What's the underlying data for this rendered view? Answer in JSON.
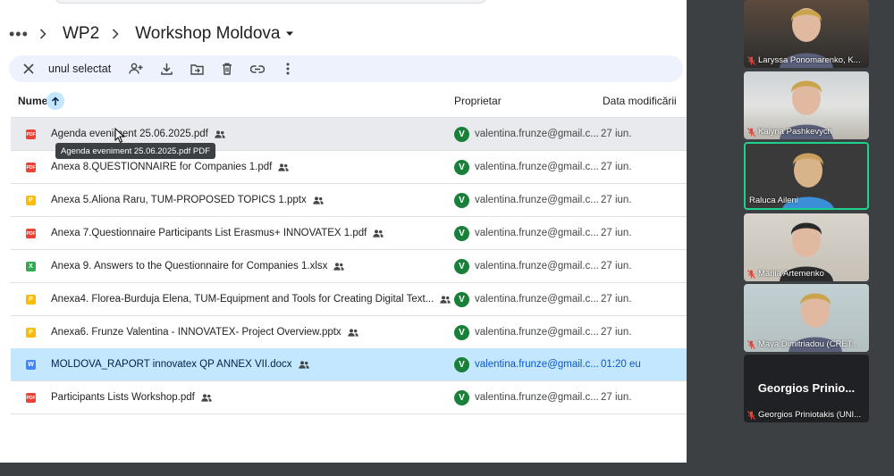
{
  "breadcrumb": {
    "more": "•••",
    "items": [
      "WP2",
      "Workshop Moldova"
    ]
  },
  "selection_bar": {
    "count_label": "unul selectat",
    "actions": [
      "close-icon",
      "share-icon",
      "download-icon",
      "move-icon",
      "trash-icon",
      "link-icon",
      "more-vert-icon"
    ]
  },
  "table": {
    "headers": {
      "name": "Nume",
      "owner": "Proprietar",
      "modified": "Data modificării"
    },
    "rows": [
      {
        "name": "Agenda eveniment 25.06.2025.pdf",
        "type": "pdf",
        "type_label": "PDF",
        "shared": true,
        "owner_initial": "V",
        "owner": "valentina.frunze@gmail.c...",
        "modified": "27 iun."
      },
      {
        "name": "Anexa  8.QUESTIONNAIRE for Companies 1.pdf",
        "type": "pdf",
        "type_label": "PDF",
        "shared": true,
        "owner_initial": "V",
        "owner": "valentina.frunze@gmail.c...",
        "modified": "27 iun."
      },
      {
        "name": "Anexa 5.Aliona Raru, TUM-PROPOSED TOPICS 1.pptx",
        "type": "pptx",
        "type_label": "P",
        "shared": true,
        "owner_initial": "V",
        "owner": "valentina.frunze@gmail.c...",
        "modified": "27 iun."
      },
      {
        "name": "Anexa 7.Questionnaire Participants List Erasmus+ INNOVATEX 1.pdf",
        "type": "pdf",
        "type_label": "PDF",
        "shared": true,
        "owner_initial": "V",
        "owner": "valentina.frunze@gmail.c...",
        "modified": "27 iun."
      },
      {
        "name": "Anexa 9. Answers to the Questionnaire for Companies 1.xlsx",
        "type": "xlsx",
        "type_label": "X",
        "shared": true,
        "owner_initial": "V",
        "owner": "valentina.frunze@gmail.c...",
        "modified": "27 iun."
      },
      {
        "name": "Anexa4. Florea-Burduja Elena, TUM-Equipment and Tools for Creating Digital Text...",
        "type": "pptx",
        "type_label": "P",
        "shared": true,
        "owner_initial": "V",
        "owner": "valentina.frunze@gmail.c...",
        "modified": "27 iun."
      },
      {
        "name": "Anexa6. Frunze Valentina -  INNOVATEX- Project Overview.pptx",
        "type": "pptx",
        "type_label": "P",
        "shared": true,
        "owner_initial": "V",
        "owner": "valentina.frunze@gmail.c...",
        "modified": "27 iun."
      },
      {
        "name": "MOLDOVA_RAPORT innovatex QP ANNEX VII.docx",
        "type": "docx",
        "type_label": "W",
        "shared": true,
        "owner_initial": "V",
        "owner": "valentina.frunze@gmail.c...",
        "modified": "01:20 eu"
      },
      {
        "name": "Participants Lists Workshop.pdf",
        "type": "pdf",
        "type_label": "PDF",
        "shared": true,
        "owner_initial": "V",
        "owner": "valentina.frunze@gmail.c...",
        "modified": "27 iun."
      }
    ]
  },
  "tooltip": "Agenda eveniment 25.06.2025.pdf PDF",
  "participants": [
    {
      "name": "Laryssa Ponomarenko, K...",
      "muted": true
    },
    {
      "name": "Kalyna Pashkevych",
      "muted": true
    },
    {
      "name": "Raluca Aileni",
      "muted": false,
      "active": true
    },
    {
      "name": "Mariia Artemenko",
      "muted": true
    },
    {
      "name": "Maya Dimitriadou (CRET...",
      "muted": true
    },
    {
      "name": "Georgios Priniotakis (UNI...",
      "muted": true,
      "display_text": "Georgios Prinio..."
    }
  ],
  "colors": {
    "selected_row": "#c2e7ff",
    "hover_row": "#e8eaed",
    "avatar": "#188038",
    "active_speaker": "#1ed28e"
  }
}
